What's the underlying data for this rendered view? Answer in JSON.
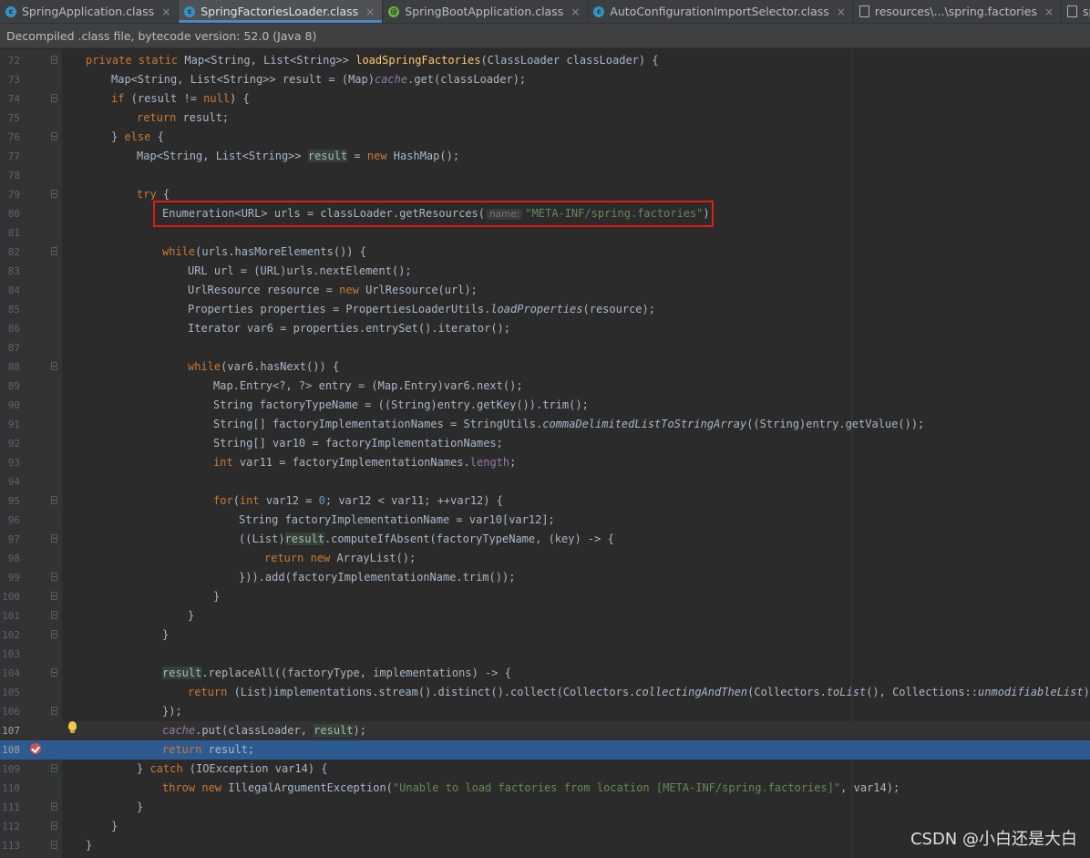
{
  "tabs": [
    {
      "label": "SpringApplication.class",
      "icon": "class-icon"
    },
    {
      "label": "SpringFactoriesLoader.class",
      "icon": "class-icon",
      "active": true
    },
    {
      "label": "SpringBootApplication.class",
      "icon": "annotation-icon"
    },
    {
      "label": "AutoConfigurationImportSelector.class",
      "icon": "class-icon"
    },
    {
      "label": "resources\\...\\spring.factories",
      "icon": "file-icon"
    },
    {
      "label": "spring-boot-a",
      "icon": "file-icon"
    }
  ],
  "info_bar": "Decompiled .class file, bytecode version: 52.0 (Java 8)",
  "line_numbers": [
    "72",
    "73",
    "74",
    "75",
    "76",
    "77",
    "78",
    "79",
    "80",
    "81",
    "82",
    "83",
    "84",
    "85",
    "86",
    "87",
    "88",
    "89",
    "90",
    "91",
    "92",
    "93",
    "94",
    "95",
    "96",
    "97",
    "98",
    "99",
    "100",
    "101",
    "102",
    "103",
    "104",
    "105",
    "106",
    "107",
    "108",
    "109",
    "110",
    "111",
    "112",
    "113"
  ],
  "code": {
    "l72_a": "private static ",
    "l72_b": "Map<String, List<String>> ",
    "l72_c": "loadSpringFactories",
    "l72_d": "(ClassLoader classLoader) {",
    "l73_a": "Map<String, List<String>> result = (Map)",
    "l73_b": "cache",
    "l73_c": ".get(classLoader);",
    "l74_a": "if",
    "l74_b": " (result != ",
    "l74_c": "null",
    "l74_d": ") {",
    "l75_a": "return",
    "l75_b": " result;",
    "l76_a": "} ",
    "l76_b": "else",
    "l76_c": " {",
    "l77_a": "Map<String, List<String>> ",
    "l77_b": "result",
    "l77_c": " = ",
    "l77_d": "new",
    "l77_e": " HashMap();",
    "l79_a": "try",
    "l79_b": " {",
    "l80_a": "Enumeration<URL> urls = classLoader.getResources(",
    "l80_hint": "name:",
    "l80_str": "\"META-INF/spring.factories\"",
    "l80_end": ");",
    "l82_a": "while",
    "l82_b": "(urls.hasMoreElements()) {",
    "l83": "URL url = (URL)urls.nextElement();",
    "l84_a": "UrlResource resource = ",
    "l84_b": "new",
    "l84_c": " UrlResource(url);",
    "l85_a": "Properties properties = PropertiesLoaderUtils.",
    "l85_b": "loadProperties",
    "l85_c": "(resource);",
    "l86": "Iterator var6 = properties.entrySet().iterator();",
    "l88_a": "while",
    "l88_b": "(var6.hasNext()) {",
    "l89": "Map.Entry<?, ?> entry = (Map.Entry)var6.next();",
    "l90": "String factoryTypeName = ((String)entry.getKey()).trim();",
    "l91_a": "String[] factoryImplementationNames = StringUtils.",
    "l91_b": "commaDelimitedListToStringArray",
    "l91_c": "((String)entry.getValue());",
    "l92": "String[] var10 = factoryImplementationNames;",
    "l93_a": "int",
    "l93_b": " var11 = factoryImplementationNames.",
    "l93_c": "length",
    "l93_d": ";",
    "l95_a": "for",
    "l95_b": "(",
    "l95_c": "int",
    "l95_d": " var12 = ",
    "l95_e": "0",
    "l95_f": "; var12 < var11; ++var12) {",
    "l96": "String factoryImplementationName = var10[var12];",
    "l97_a": "((List)",
    "l97_b": "result",
    "l97_c": ".computeIfAbsent(factoryTypeName, (key) -> {",
    "l98_a": "return",
    "l98_b": " ",
    "l98_c": "new",
    "l98_d": " ArrayList();",
    "l99": "})).add(factoryImplementationName.trim());",
    "l100": "}",
    "l101": "}",
    "l102": "}",
    "l104_a": "result",
    "l104_b": ".replaceAll((factoryType, implementations) -> {",
    "l105_a": "return",
    "l105_b": " (List)implementations.stream().distinct().collect(Collectors.",
    "l105_c": "collectingAndThen",
    "l105_d": "(Collectors.",
    "l105_e": "toList",
    "l105_f": "(), Collections::",
    "l105_g": "unmodifiableList",
    "l105_h": "));",
    "l106": "});",
    "l107_a": "cache",
    "l107_b": ".put(classLoader, ",
    "l107_c": "result",
    "l107_d": ");",
    "l108_a": "return",
    "l108_b": " result;",
    "l109_a": "} ",
    "l109_b": "catch",
    "l109_c": " (IOException var14) {",
    "l110_a": "throw",
    "l110_b": " ",
    "l110_c": "new",
    "l110_d": " IllegalArgumentException(",
    "l110_e": "\"Unable to load factories from location [META-INF/spring.factories]\"",
    "l110_f": ", var14);",
    "l111": "}",
    "l112": "}",
    "l113": "}"
  },
  "watermark": "CSDN @小白还是大白",
  "colors": {
    "keyword": "#cc7832",
    "method": "#ffc66d",
    "string": "#6a8759",
    "number": "#6897bb",
    "field": "#9876aa",
    "text": "#a9b7c6",
    "highlight_box": "#e11c1c",
    "execution_line": "#2d5b91"
  }
}
